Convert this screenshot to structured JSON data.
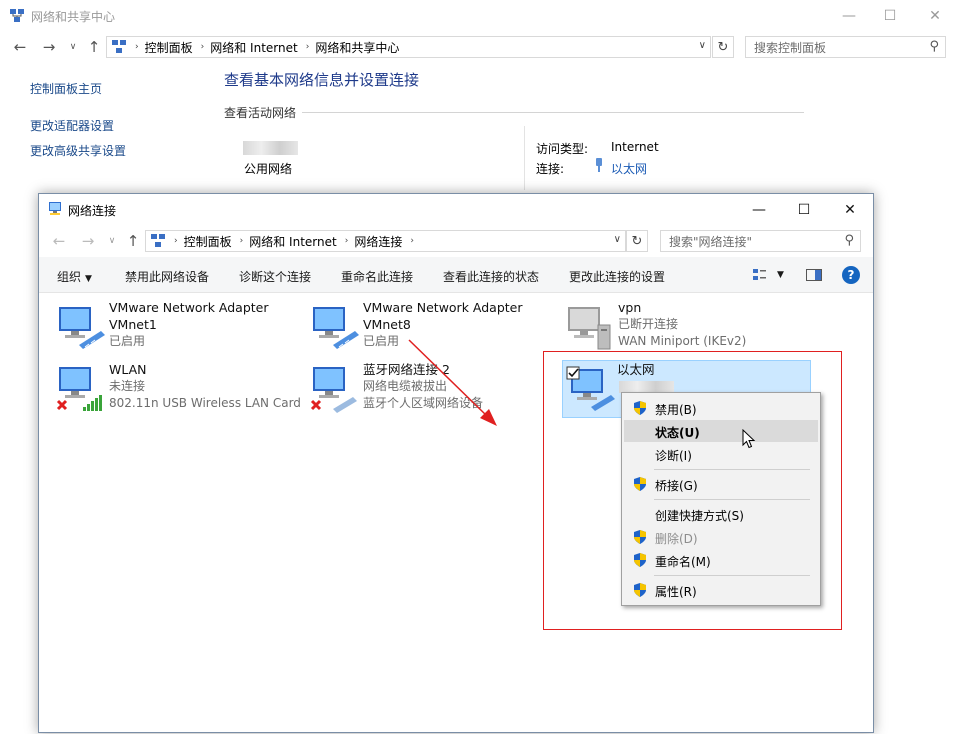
{
  "back_window": {
    "title": "网络和共享中心",
    "controls": {
      "minimize": "—",
      "maximize": "☐",
      "close": "✕"
    },
    "breadcrumb": [
      "控制面板",
      "网络和 Internet",
      "网络和共享中心"
    ],
    "search_placeholder": "搜索控制面板",
    "left_links": [
      "控制面板主页",
      "更改适配器设置",
      "更改高级共享设置"
    ],
    "main_title": "查看基本网络信息并设置连接",
    "active_section_label": "查看活动网络",
    "network_type": "公用网络",
    "access_type_label": "访问类型:",
    "access_type_value": "Internet",
    "connection_label": "连接:",
    "connection_value": "以太网"
  },
  "front_window": {
    "title": "网络连接",
    "controls": {
      "minimize": "—",
      "maximize": "☐",
      "close": "✕"
    },
    "breadcrumb": [
      "控制面板",
      "网络和 Internet",
      "网络连接"
    ],
    "search_placeholder": "搜索\"网络连接\"",
    "commands": [
      "组织",
      "禁用此网络设备",
      "诊断这个连接",
      "重命名此连接",
      "查看此连接的状态",
      "更改此连接的设置"
    ],
    "help": "?",
    "adapters": [
      {
        "name_line1": "VMware Network Adapter",
        "name_line2": "VMnet1",
        "status": "已启用",
        "detail": ""
      },
      {
        "name_line1": "VMware Network Adapter",
        "name_line2": "VMnet8",
        "status": "已启用",
        "detail": ""
      },
      {
        "name_line1": "vpn",
        "name_line2": "",
        "status": "已断开连接",
        "detail": "WAN Miniport (IKEv2)"
      },
      {
        "name_line1": "WLAN",
        "name_line2": "",
        "status": "未连接",
        "detail": "802.11n USB Wireless LAN Card"
      },
      {
        "name_line1": "蓝牙网络连接 2",
        "name_line2": "",
        "status": "网络电缆被拔出",
        "detail": "蓝牙个人区域网络设备"
      },
      {
        "name_line1": "以太网",
        "name_line2": "",
        "status": "",
        "detail": ""
      }
    ]
  },
  "context_menu": {
    "items": [
      {
        "label": "禁用(B)",
        "shield": true
      },
      {
        "label": "状态(U)",
        "shield": false
      },
      {
        "label": "诊断(I)",
        "shield": false
      },
      {
        "label": "桥接(G)",
        "shield": true
      },
      {
        "label": "创建快捷方式(S)",
        "shield": false
      },
      {
        "label": "删除(D)",
        "shield": true
      },
      {
        "label": "重命名(M)",
        "shield": true
      },
      {
        "label": "属性(R)",
        "shield": true
      }
    ]
  },
  "colors": {
    "annotation_red": "#e02020",
    "link_blue": "#1b4a8a",
    "selection": "#cce8ff",
    "shield_blue": "#1e63c9",
    "shield_yellow": "#f5c400"
  }
}
